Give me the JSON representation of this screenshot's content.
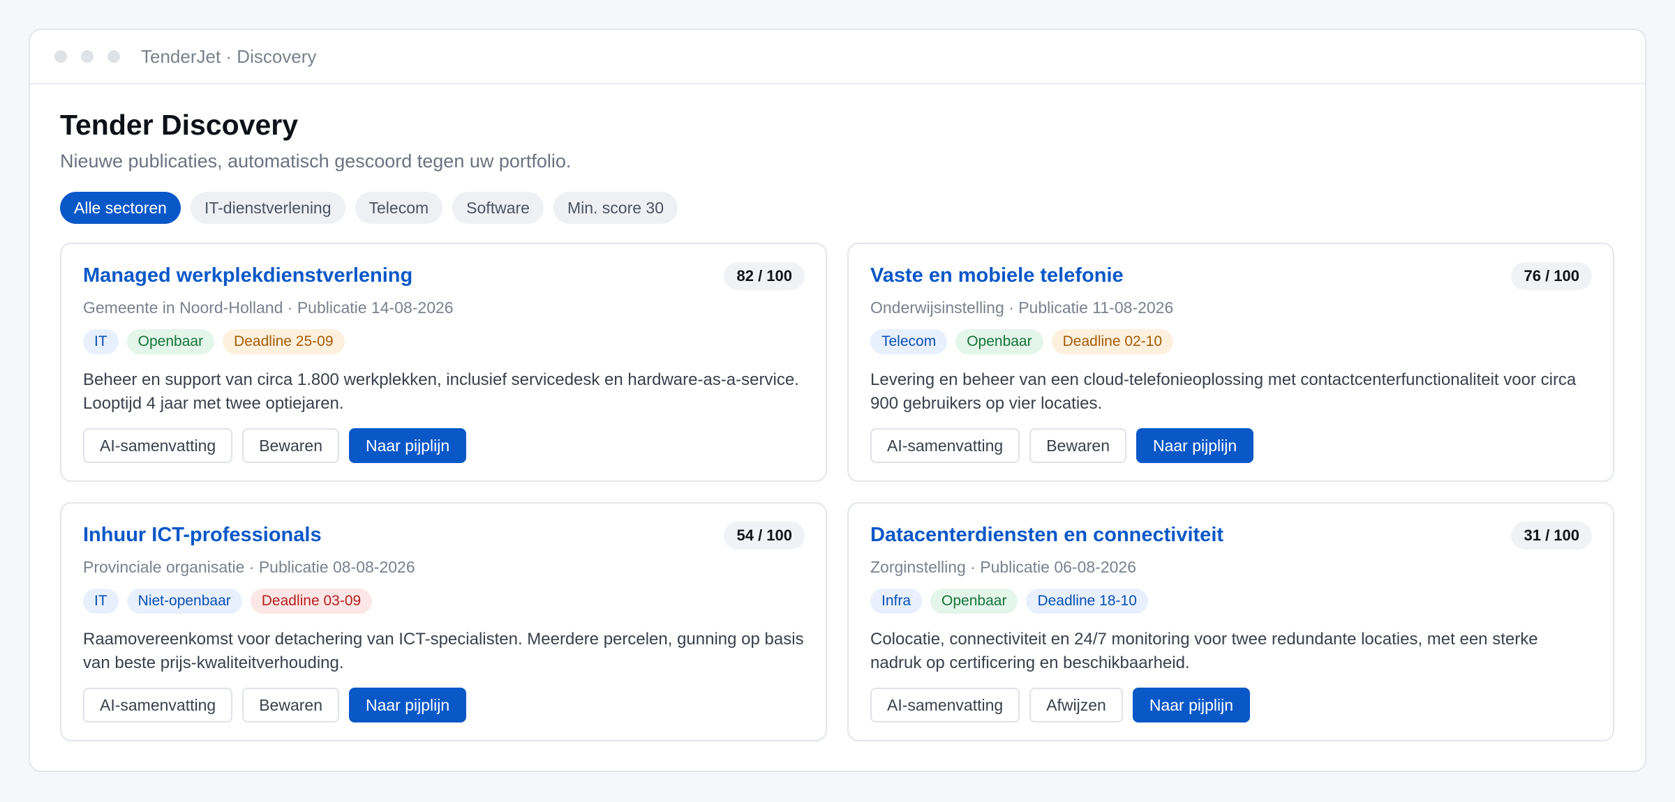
{
  "window": {
    "title": "TenderJet · Discovery"
  },
  "page": {
    "title": "Tender Discovery",
    "subtitle": "Nieuwe publicaties, automatisch gescoord tegen uw portfolio."
  },
  "filters": [
    {
      "label": "Alle sectoren",
      "active": true
    },
    {
      "label": "IT-dienstverlening",
      "active": false
    },
    {
      "label": "Telecom",
      "active": false
    },
    {
      "label": "Software",
      "active": false
    },
    {
      "label": "Min. score 30",
      "active": false
    }
  ],
  "tenders": [
    {
      "title": "Managed werkplekdienstverlening",
      "score": "82 / 100",
      "meta": "Gemeente in Noord-Holland · Publicatie 14-08-2026",
      "tags": [
        "IT",
        "Openbaar",
        "Deadline 25-09"
      ],
      "description": "Beheer en support van circa 1.800 werkplekken, inclusief servicedesk en hardware-as-a-service. Looptijd 4 jaar met twee optiejaren.",
      "actions": [
        "AI-samenvatting",
        "Bewaren",
        "Naar pijplijn"
      ]
    },
    {
      "title": "Vaste en mobiele telefonie",
      "score": "76 / 100",
      "meta": "Onderwijsinstelling · Publicatie 11-08-2026",
      "tags": [
        "Telecom",
        "Openbaar",
        "Deadline 02-10"
      ],
      "description": "Levering en beheer van een cloud-telefonieoplossing met contactcenterfunctionaliteit voor circa 900 gebruikers op vier locaties.",
      "actions": [
        "AI-samenvatting",
        "Bewaren",
        "Naar pijplijn"
      ]
    },
    {
      "title": "Inhuur ICT-professionals",
      "score": "54 / 100",
      "meta": "Provinciale organisatie · Publicatie 08-08-2026",
      "tags": [
        "IT",
        "Niet-openbaar",
        "Deadline 03-09"
      ],
      "description": "Raamovereenkomst voor detachering van ICT-specialisten. Meerdere percelen, gunning op basis van beste prijs-kwaliteitverhouding.",
      "actions": [
        "AI-samenvatting",
        "Bewaren",
        "Naar pijplijn"
      ]
    },
    {
      "title": "Datacenterdiensten en connectiviteit",
      "score": "31 / 100",
      "meta": "Zorginstelling · Publicatie 06-08-2026",
      "tags": [
        "Infra",
        "Openbaar",
        "Deadline 18-10"
      ],
      "description": "Colocatie, connectiviteit en 24/7 monitoring voor twee redundante locaties, met een sterke nadruk op certificering en beschikbaarheid.",
      "actions": [
        "AI-samenvatting",
        "Afwijzen",
        "Naar pijplijn"
      ]
    }
  ],
  "colors": {
    "accent": "#0a58c8",
    "tag_blue": "#e8f0fd",
    "tag_green": "#e4f5ea",
    "tag_orange": "#fdf0dd",
    "tag_red": "#fde6e6"
  }
}
